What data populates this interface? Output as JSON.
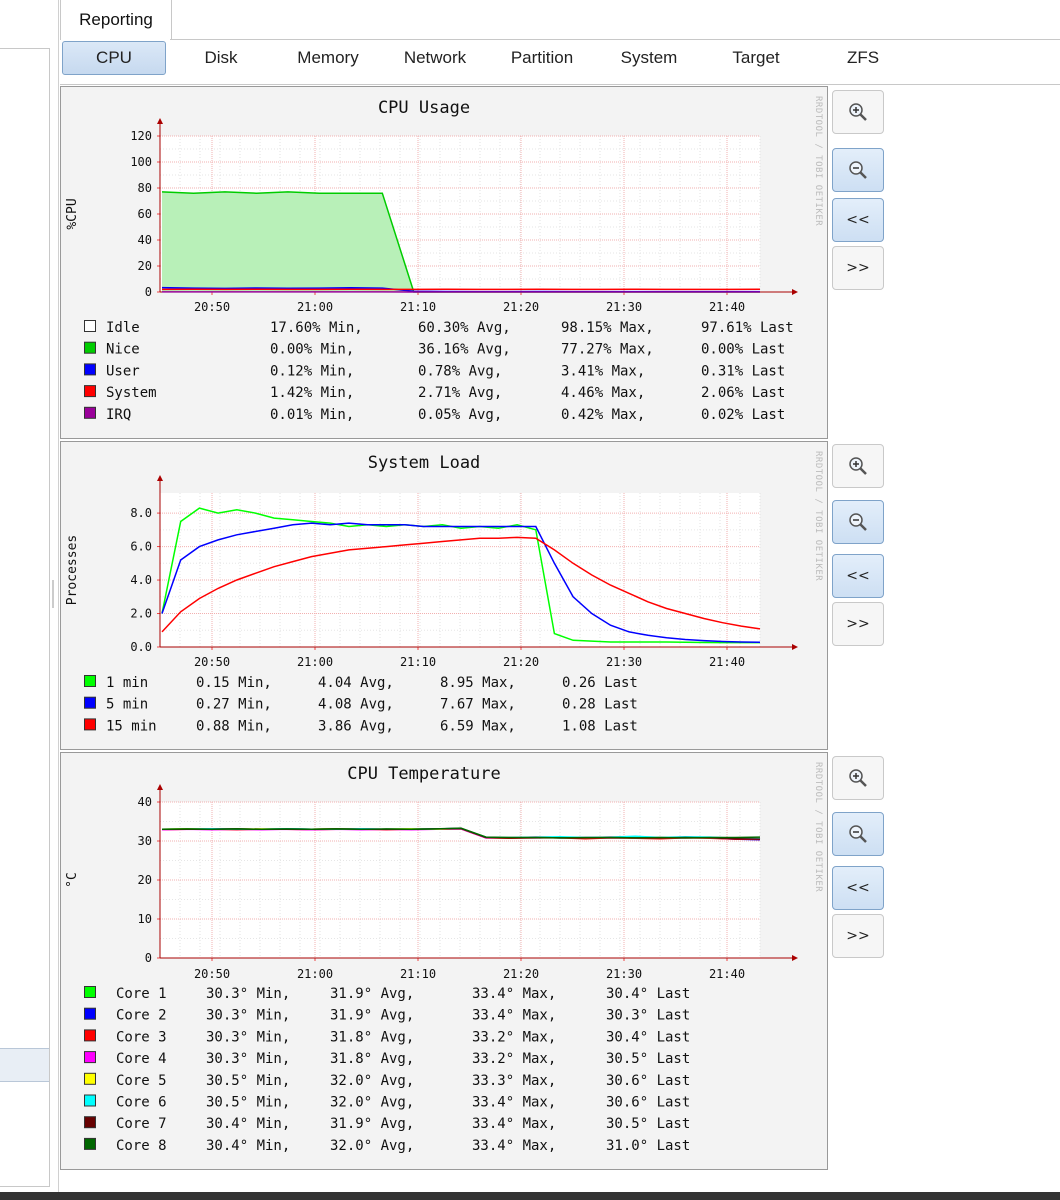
{
  "main_tab": {
    "label": "Reporting"
  },
  "subtabs": [
    {
      "label": "CPU",
      "active": true
    },
    {
      "label": "Disk",
      "active": false
    },
    {
      "label": "Memory",
      "active": false
    },
    {
      "label": "Network",
      "active": false
    },
    {
      "label": "Partition",
      "active": false
    },
    {
      "label": "System",
      "active": false
    },
    {
      "label": "Target",
      "active": false
    },
    {
      "label": "ZFS",
      "active": false
    }
  ],
  "watermark": "RRDTOOL / TOBI OETIKER",
  "buttons": {
    "prev": "<<",
    "next": ">>",
    "zoom_in_icon": "zoom-in-icon",
    "zoom_out_icon": "zoom-out-icon"
  },
  "chart_data": [
    {
      "type": "area",
      "title": "CPU Usage",
      "ylabel": "%CPU",
      "xlabel": "",
      "ylim": [
        0,
        120
      ],
      "yticks": [
        "0",
        "20",
        "40",
        "60",
        "80",
        "100",
        "120"
      ],
      "xticks": [
        "20:50",
        "21:00",
        "21:10",
        "21:20",
        "21:30",
        "21:40"
      ],
      "series": [
        {
          "name": "Idle",
          "color": "#ffffff",
          "values": [
            18,
            18,
            18,
            18,
            18,
            18,
            18,
            18,
            97,
            97,
            97,
            97,
            97,
            97,
            97,
            97,
            97,
            97,
            97,
            97
          ]
        },
        {
          "name": "Nice",
          "color": "#00cc00",
          "values": [
            77,
            76,
            77,
            76,
            77,
            76,
            76,
            76,
            0,
            0,
            0,
            0,
            0,
            0,
            0,
            0,
            0,
            0,
            0,
            0
          ]
        },
        {
          "name": "User",
          "color": "#0000ff",
          "values": [
            3.4,
            3.0,
            2.8,
            3.1,
            2.9,
            3.0,
            3.2,
            3.0,
            0.5,
            0.4,
            0.3,
            0.3,
            0.4,
            0.3,
            0.3,
            0.3,
            0.3,
            0.3,
            0.3,
            0.31
          ]
        },
        {
          "name": "System",
          "color": "#ff0000",
          "values": [
            2.0,
            2.1,
            2.0,
            2.1,
            2.0,
            2.0,
            2.1,
            2.0,
            2.0,
            2.1,
            2.0,
            2.0,
            2.1,
            2.0,
            2.0,
            2.1,
            2.0,
            2.0,
            2.0,
            2.06
          ]
        },
        {
          "name": "IRQ",
          "color": "#990099",
          "values": [
            0.05,
            0.05,
            0.05,
            0.05,
            0.05,
            0.05,
            0.05,
            0.05,
            0.02,
            0.02,
            0.02,
            0.02,
            0.02,
            0.02,
            0.02,
            0.02,
            0.02,
            0.02,
            0.02,
            0.02
          ]
        }
      ],
      "legend": [
        {
          "name": "Idle",
          "color": "#ffffff",
          "min": "17.60% Min,",
          "avg": "60.30% Avg,",
          "max": "98.15% Max,",
          "last": "97.61% Last"
        },
        {
          "name": "Nice",
          "color": "#00cc00",
          "min": "0.00% Min,",
          "avg": "36.16% Avg,",
          "max": "77.27% Max,",
          "last": "0.00% Last"
        },
        {
          "name": "User",
          "color": "#0000ff",
          "min": "0.12% Min,",
          "avg": "0.78% Avg,",
          "max": "3.41% Max,",
          "last": "0.31% Last"
        },
        {
          "name": "System",
          "color": "#ff0000",
          "min": "1.42% Min,",
          "avg": "2.71% Avg,",
          "max": "4.46% Max,",
          "last": "2.06% Last"
        },
        {
          "name": "IRQ",
          "color": "#990099",
          "min": "0.01% Min,",
          "avg": "0.05% Avg,",
          "max": "0.42% Max,",
          "last": "0.02% Last"
        }
      ]
    },
    {
      "type": "line",
      "title": "System Load",
      "ylabel": "Processes",
      "xlabel": "",
      "ylim": [
        0,
        9.2
      ],
      "yticks": [
        "0.0",
        "2.0",
        "4.0",
        "6.0",
        "8.0"
      ],
      "xticks": [
        "20:50",
        "21:00",
        "21:10",
        "21:20",
        "21:30",
        "21:40"
      ],
      "series": [
        {
          "name": "1 min",
          "color": "#00ff00",
          "values": [
            2.0,
            7.5,
            8.3,
            8.0,
            8.2,
            8.0,
            7.7,
            7.6,
            7.5,
            7.4,
            7.2,
            7.3,
            7.2,
            7.3,
            7.2,
            7.3,
            7.1,
            7.2,
            7.1,
            7.3,
            7.0,
            0.8,
            0.4,
            0.35,
            0.3,
            0.3,
            0.3,
            0.3,
            0.28,
            0.27,
            0.26,
            0.26,
            0.26
          ]
        },
        {
          "name": "5 min",
          "color": "#0000ff",
          "values": [
            2.0,
            5.2,
            6.0,
            6.4,
            6.7,
            6.9,
            7.1,
            7.3,
            7.4,
            7.3,
            7.4,
            7.3,
            7.3,
            7.3,
            7.2,
            7.2,
            7.2,
            7.2,
            7.2,
            7.2,
            7.2,
            5.0,
            3.0,
            2.0,
            1.3,
            0.9,
            0.7,
            0.55,
            0.45,
            0.38,
            0.33,
            0.3,
            0.28
          ]
        },
        {
          "name": "15 min",
          "color": "#ff0000",
          "values": [
            0.9,
            2.1,
            2.9,
            3.5,
            4.0,
            4.4,
            4.8,
            5.1,
            5.4,
            5.6,
            5.8,
            5.9,
            6.0,
            6.1,
            6.2,
            6.3,
            6.4,
            6.5,
            6.5,
            6.55,
            6.5,
            5.8,
            5.0,
            4.3,
            3.7,
            3.2,
            2.7,
            2.3,
            2.0,
            1.7,
            1.45,
            1.25,
            1.08
          ]
        }
      ],
      "legend": [
        {
          "name": "1 min",
          "color": "#00ff00",
          "min": "0.15 Min,",
          "avg": "4.04 Avg,",
          "max": "8.95 Max,",
          "last": "0.26 Last"
        },
        {
          "name": "5 min",
          "color": "#0000ff",
          "min": "0.27 Min,",
          "avg": "4.08 Avg,",
          "max": "7.67 Max,",
          "last": "0.28 Last"
        },
        {
          "name": "15 min",
          "color": "#ff0000",
          "min": "0.88 Min,",
          "avg": "3.86 Avg,",
          "max": "6.59 Max,",
          "last": "1.08 Last"
        }
      ]
    },
    {
      "type": "line",
      "title": "CPU Temperature",
      "ylabel": "°C",
      "xlabel": "",
      "ylim": [
        0,
        40
      ],
      "yticks": [
        "0",
        "10",
        "20",
        "30",
        "40"
      ],
      "xticks": [
        "20:50",
        "21:00",
        "21:10",
        "21:20",
        "21:30",
        "21:40"
      ],
      "series": [
        {
          "name": "Core 1",
          "color": "#00ff00",
          "values": [
            33.0,
            33.1,
            33.0,
            33.1,
            33.0,
            33.1,
            33.0,
            33.1,
            33.0,
            33.0,
            33.1,
            33.0,
            33.2,
            31.0,
            30.8,
            30.9,
            30.8,
            30.7,
            30.9,
            30.8,
            30.7,
            30.9,
            30.8,
            30.6,
            30.4
          ]
        },
        {
          "name": "Core 2",
          "color": "#0000ff",
          "values": [
            33.0,
            33.0,
            33.1,
            33.0,
            33.0,
            33.1,
            33.0,
            33.0,
            33.1,
            33.0,
            33.0,
            33.1,
            33.2,
            30.9,
            30.8,
            30.8,
            30.9,
            30.7,
            30.8,
            30.8,
            30.7,
            30.8,
            30.8,
            30.5,
            30.3
          ]
        },
        {
          "name": "Core 3",
          "color": "#ff0000",
          "values": [
            32.9,
            33.0,
            33.0,
            32.9,
            33.0,
            33.0,
            32.9,
            33.0,
            33.0,
            32.9,
            33.0,
            33.0,
            33.1,
            30.8,
            30.7,
            30.8,
            30.8,
            30.6,
            30.8,
            30.7,
            30.6,
            30.8,
            30.7,
            30.5,
            30.4
          ]
        },
        {
          "name": "Core 4",
          "color": "#ff00ff",
          "values": [
            32.9,
            33.0,
            32.9,
            33.0,
            32.9,
            33.0,
            32.9,
            33.0,
            32.9,
            33.0,
            32.9,
            33.0,
            33.1,
            30.8,
            30.9,
            31.0,
            30.8,
            30.9,
            31.0,
            30.8,
            30.9,
            30.8,
            30.8,
            30.6,
            30.5
          ]
        },
        {
          "name": "Core 5",
          "color": "#ffff00",
          "values": [
            33.0,
            33.1,
            33.0,
            33.0,
            33.1,
            33.0,
            33.0,
            33.1,
            33.0,
            33.0,
            33.1,
            33.0,
            33.2,
            31.0,
            30.9,
            30.9,
            31.0,
            30.8,
            30.9,
            31.0,
            30.9,
            30.8,
            30.8,
            30.7,
            30.6
          ]
        },
        {
          "name": "Core 6",
          "color": "#00ffff",
          "values": [
            33.0,
            33.0,
            33.1,
            33.0,
            33.0,
            33.1,
            33.0,
            33.0,
            33.1,
            33.0,
            33.0,
            33.1,
            33.2,
            31.0,
            30.9,
            31.0,
            31.1,
            30.9,
            31.0,
            31.2,
            30.9,
            31.1,
            31.0,
            30.7,
            30.6
          ]
        },
        {
          "name": "Core 7",
          "color": "#660000",
          "values": [
            33.0,
            33.0,
            33.0,
            33.1,
            33.0,
            33.0,
            33.0,
            33.1,
            33.0,
            33.0,
            33.0,
            33.1,
            33.2,
            30.9,
            30.8,
            30.9,
            30.8,
            30.8,
            30.9,
            30.8,
            30.8,
            30.9,
            30.8,
            30.6,
            30.5
          ]
        },
        {
          "name": "Core 8",
          "color": "#006600",
          "values": [
            33.0,
            33.1,
            33.0,
            33.1,
            33.0,
            33.1,
            33.0,
            33.1,
            33.0,
            33.1,
            33.0,
            33.1,
            33.3,
            31.0,
            30.9,
            30.9,
            30.8,
            30.9,
            30.9,
            30.8,
            30.9,
            30.8,
            30.9,
            30.9,
            31.0
          ]
        }
      ],
      "legend": [
        {
          "name": "Core 1",
          "color": "#00ff00",
          "min": "30.3° Min,",
          "avg": "31.9° Avg,",
          "max": "33.4° Max,",
          "last": "30.4° Last"
        },
        {
          "name": "Core 2",
          "color": "#0000ff",
          "min": "30.3° Min,",
          "avg": "31.9° Avg,",
          "max": "33.4° Max,",
          "last": "30.3° Last"
        },
        {
          "name": "Core 3",
          "color": "#ff0000",
          "min": "30.3° Min,",
          "avg": "31.8° Avg,",
          "max": "33.2° Max,",
          "last": "30.4° Last"
        },
        {
          "name": "Core 4",
          "color": "#ff00ff",
          "min": "30.3° Min,",
          "avg": "31.8° Avg,",
          "max": "33.2° Max,",
          "last": "30.5° Last"
        },
        {
          "name": "Core 5",
          "color": "#ffff00",
          "min": "30.5° Min,",
          "avg": "32.0° Avg,",
          "max": "33.3° Max,",
          "last": "30.6° Last"
        },
        {
          "name": "Core 6",
          "color": "#00ffff",
          "min": "30.5° Min,",
          "avg": "32.0° Avg,",
          "max": "33.4° Max,",
          "last": "30.6° Last"
        },
        {
          "name": "Core 7",
          "color": "#660000",
          "min": "30.4° Min,",
          "avg": "31.9° Avg,",
          "max": "33.4° Max,",
          "last": "30.5° Last"
        },
        {
          "name": "Core 8",
          "color": "#006600",
          "min": "30.4° Min,",
          "avg": "32.0° Avg,",
          "max": "33.4° Max,",
          "last": "31.0° Last"
        }
      ]
    }
  ]
}
